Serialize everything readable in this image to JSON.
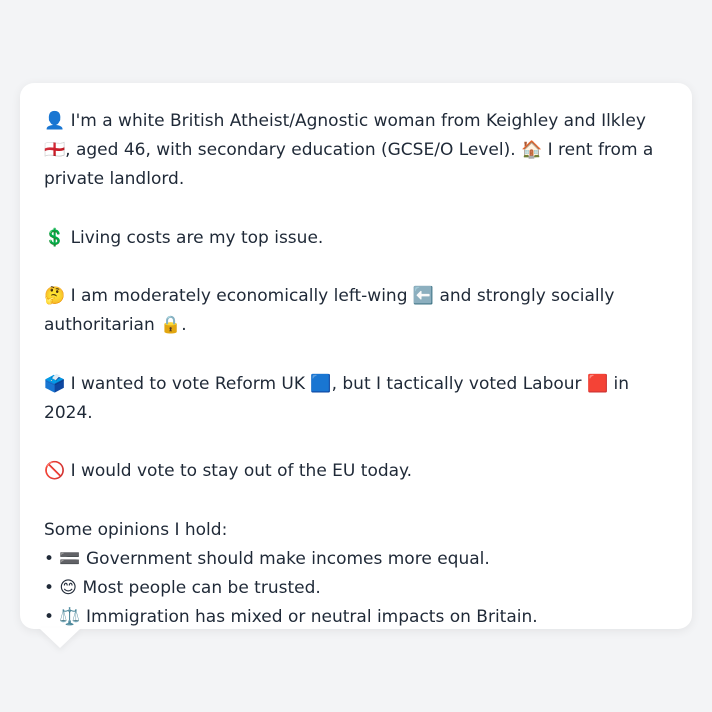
{
  "profile": {
    "intro": "👤 I'm a white British Atheist/Agnostic woman from Keighley and Ilkley 🏴󠁧󠁢󠁥󠁮󠁧󠁿, aged 46, with secondary education (GCSE/O Level). 🏠 I rent from a private landlord.",
    "top_issue": "💲 Living costs are my top issue.",
    "ideology": "🤔 I am moderately economically left-wing ⬅️ and strongly socially authoritarian 🔒.",
    "vote_2024": "🗳️ I wanted to vote Reform UK 🟦, but I tactically voted Labour 🟥 in 2024.",
    "eu_stance": "🚫 I would vote to stay out of the EU today.",
    "opinions_heading": "Some opinions I hold:",
    "opinions": [
      "• 🟰 Government should make incomes more equal.",
      "• 😊 Most people can be trusted.",
      "• ⚖️ Immigration has mixed or neutral impacts on Britain."
    ]
  }
}
